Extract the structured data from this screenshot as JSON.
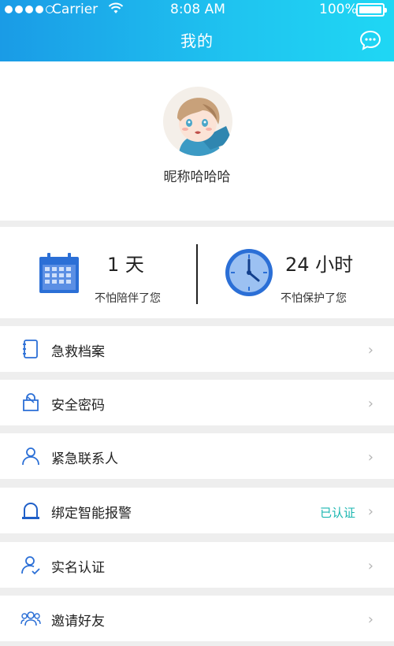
{
  "status_bar": {
    "carrier": "Carrier",
    "time": "8:08 AM",
    "battery": "100%"
  },
  "header": {
    "title": "我的",
    "message_icon": "chat-bubble-icon"
  },
  "profile": {
    "nickname": "昵称哈哈哈",
    "avatar_icon": "avatar"
  },
  "stats": [
    {
      "value": "1 天",
      "caption": "不怕陪伴了您",
      "icon": "calendar-icon"
    },
    {
      "value": "24 小时",
      "caption": "不怕保护了您",
      "icon": "clock-icon"
    }
  ],
  "menu": [
    {
      "label": "急救档案",
      "icon": "notebook-icon",
      "status": ""
    },
    {
      "label": "安全密码",
      "icon": "lock-bag-icon",
      "status": ""
    },
    {
      "label": "紧急联系人",
      "icon": "person-icon",
      "status": ""
    },
    {
      "label": "绑定智能报警",
      "icon": "alarm-icon",
      "status": "已认证"
    },
    {
      "label": "实名认证",
      "icon": "verified-user-icon",
      "status": ""
    },
    {
      "label": "邀请好友",
      "icon": "group-icon",
      "status": ""
    }
  ],
  "colors": {
    "header_start": "#1a9be6",
    "header_end": "#1fd7f4",
    "accent_blue": "#2b6fd6",
    "status_teal": "#1ab6b0"
  }
}
